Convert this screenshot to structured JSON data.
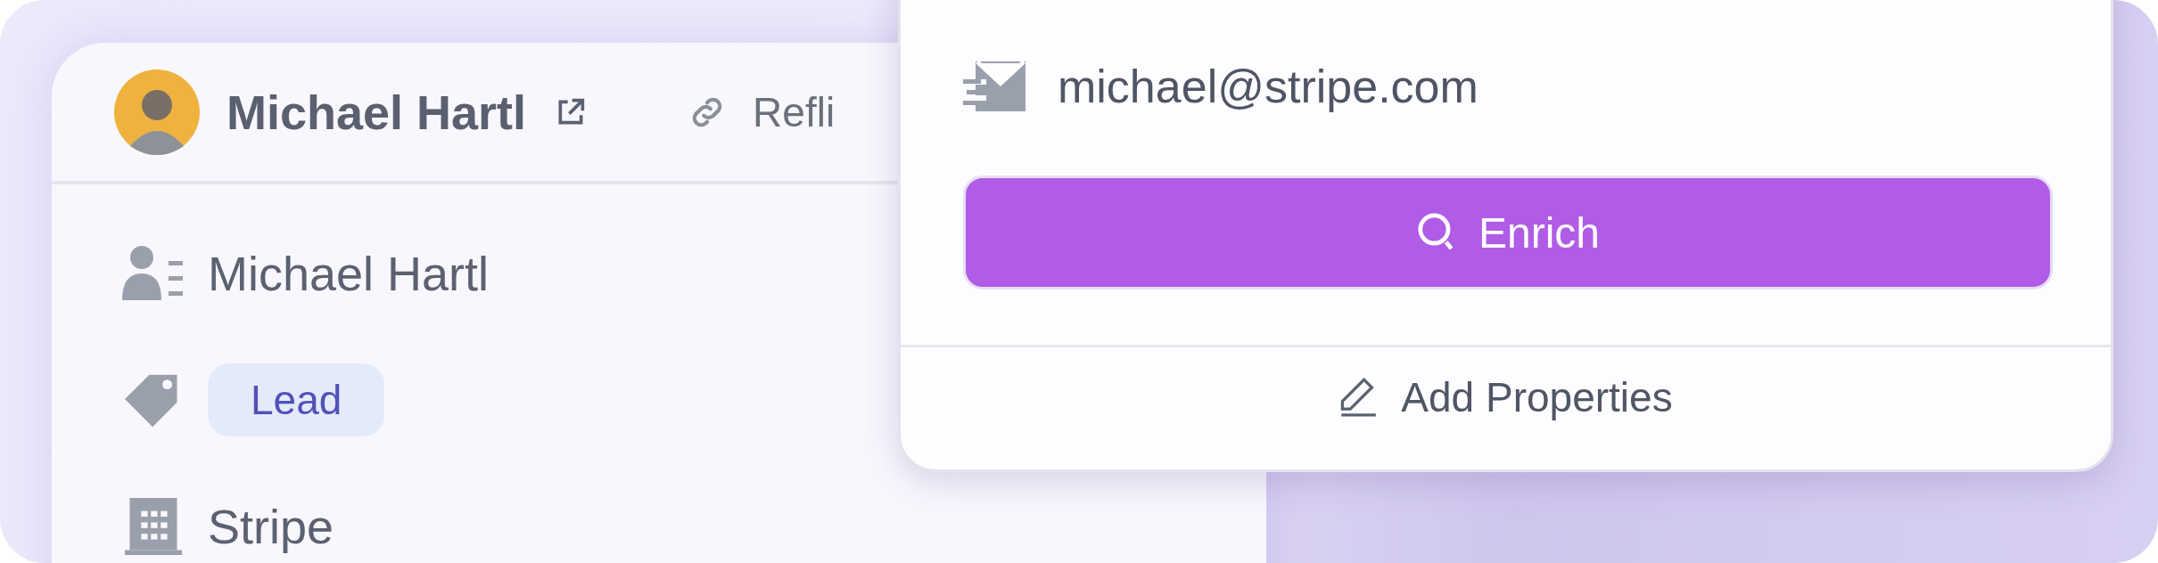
{
  "header": {
    "name": "Michael Hartl",
    "link": "Refli"
  },
  "properties": [
    {
      "kind": "person",
      "text": "Michael Hartl"
    },
    {
      "kind": "tag",
      "text": "Lead"
    },
    {
      "kind": "company",
      "text": "Stripe"
    }
  ],
  "popover": {
    "email": "michael@stripe.com",
    "enrich_button": "Enrich",
    "add_button": "Add Properties"
  }
}
